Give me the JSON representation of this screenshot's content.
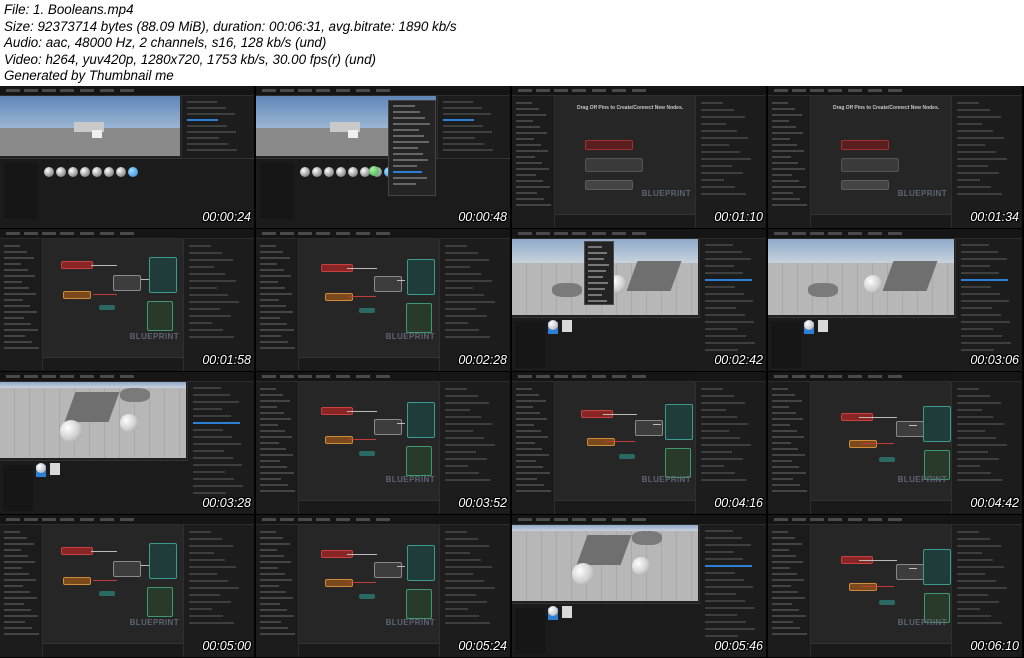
{
  "header": {
    "file": "File: 1. Booleans.mp4",
    "size": "Size: 92373714 bytes (88.09 MiB), duration: 00:06:31, avg.bitrate: 1890 kb/s",
    "audio": "Audio: aac, 48000 Hz, 2 channels, s16, 128 kb/s (und)",
    "video": "Video: h264, yuv420p, 1280x720, 1753 kb/s, 30.00 fps(r) (und)",
    "generator": "Generated by Thumbnail me"
  },
  "thumbs": [
    {
      "time": "00:00:24",
      "kind": "viewport-dark"
    },
    {
      "time": "00:00:48",
      "kind": "viewport-menu"
    },
    {
      "time": "00:01:10",
      "kind": "graph-hint"
    },
    {
      "time": "00:01:34",
      "kind": "graph-hint"
    },
    {
      "time": "00:01:58",
      "kind": "graph-nodes"
    },
    {
      "time": "00:02:28",
      "kind": "graph-nodes"
    },
    {
      "time": "00:02:42",
      "kind": "scene-menu"
    },
    {
      "time": "00:03:06",
      "kind": "scene"
    },
    {
      "time": "00:03:28",
      "kind": "scene-balls"
    },
    {
      "time": "00:03:52",
      "kind": "graph-nodes"
    },
    {
      "time": "00:04:16",
      "kind": "graph-nodes"
    },
    {
      "time": "00:04:42",
      "kind": "graph-nodes"
    },
    {
      "time": "00:05:00",
      "kind": "graph-nodes"
    },
    {
      "time": "00:05:24",
      "kind": "graph-nodes"
    },
    {
      "time": "00:05:46",
      "kind": "scene-balls"
    },
    {
      "time": "00:06:10",
      "kind": "graph-nodes"
    }
  ],
  "graph_labels": {
    "blueprint": "BLUEPRINT",
    "hint": "Drag Off Pins to Create/Connect New Nodes."
  },
  "colors": {
    "background": "#000000",
    "editor_dark": "#202020",
    "accent_blue": "#2d7fd6",
    "node_red": "#a33030",
    "node_orange": "#c9772a",
    "node_teal": "#2f8a82"
  }
}
